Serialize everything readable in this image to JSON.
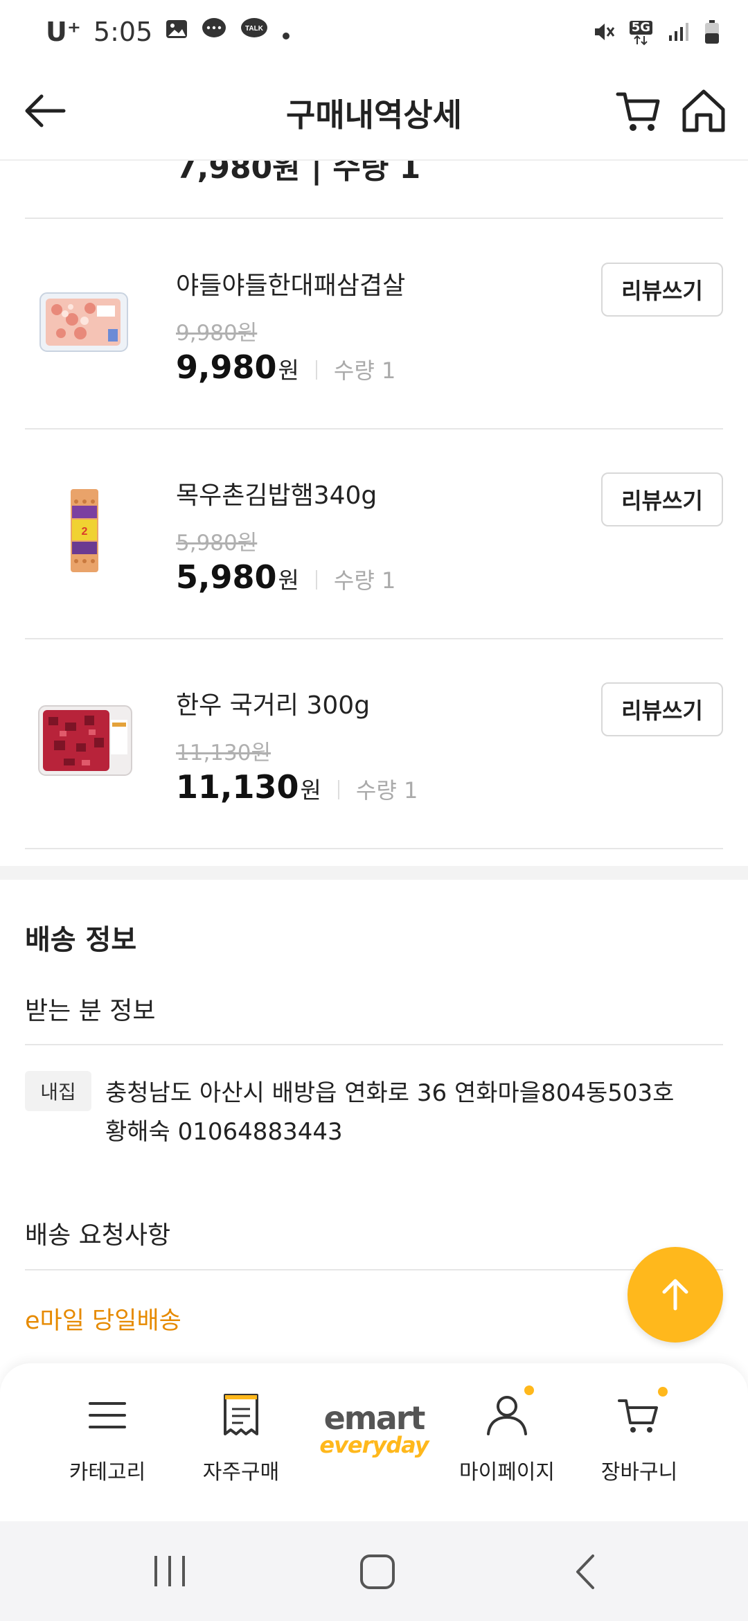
{
  "status_bar": {
    "carrier": "U⁺",
    "time": "5:05",
    "network": "5G"
  },
  "header": {
    "title": "구매내역상세"
  },
  "items": [
    {
      "name": "야들야들한대패삼겹살",
      "original_price": "9,980원",
      "price": "9,980",
      "won": "원",
      "qty": "수량 1",
      "review": "리뷰쓰기"
    },
    {
      "name": "목우촌김밥햄340g",
      "original_price": "5,980원",
      "price": "5,980",
      "won": "원",
      "qty": "수량 1",
      "review": "리뷰쓰기"
    },
    {
      "name": "한우 국거리 300g",
      "original_price": "11,130원",
      "price": "11,130",
      "won": "원",
      "qty": "수량 1",
      "review": "리뷰쓰기"
    }
  ],
  "cut_item": {
    "price": "7,980원 | 수량 1"
  },
  "delivery": {
    "title": "배송 정보",
    "recipient_title": "받는 분 정보",
    "tag": "내집",
    "address": "충청남도 아산시 배방읍 연화로 36 연화마을804동503호",
    "name_phone": "황해숙 01064883443",
    "request_title": "배송 요청사항",
    "request_value": "e마일 당일배송"
  },
  "bottom_nav": {
    "category": "카테고리",
    "frequent": "자주구매",
    "logo_top": "emart",
    "logo_bottom": "everyday",
    "mypage": "마이페이지",
    "cart": "장바구니"
  },
  "colors": {
    "accent": "#ffb81c",
    "request_text": "#e68a00"
  }
}
